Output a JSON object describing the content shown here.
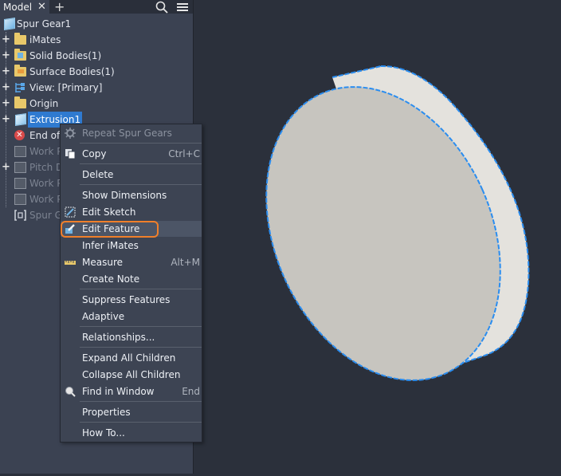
{
  "tabs": {
    "model_label": "Model",
    "close_glyph": "✕",
    "add_glyph": "+"
  },
  "tree": {
    "root": "Spur Gear1",
    "items": [
      {
        "label": "iMates",
        "icon": "folder-icon"
      },
      {
        "label": "Solid Bodies(1)",
        "icon": "solid-bodies-icon"
      },
      {
        "label": "Surface Bodies(1)",
        "icon": "surface-bodies-icon"
      },
      {
        "label": "View: [Primary]",
        "icon": "view-icon"
      },
      {
        "label": "Origin",
        "icon": "folder-icon"
      },
      {
        "label": "Extrusion1",
        "icon": "extrusion-icon",
        "selected": true
      },
      {
        "label": "End of",
        "icon": "error-icon"
      },
      {
        "label": "Work P",
        "icon": "work-plane-icon"
      },
      {
        "label": "Pitch D",
        "icon": "work-plane-icon"
      },
      {
        "label": "Work P",
        "icon": "work-plane-icon"
      },
      {
        "label": "Work P",
        "icon": "work-plane-icon"
      },
      {
        "label": "Spur G",
        "icon": "spur-gear-icon"
      }
    ]
  },
  "context_menu": {
    "repeat": "Repeat Spur Gears",
    "copy": "Copy",
    "copy_shortcut": "Ctrl+C",
    "delete": "Delete",
    "show_dimensions": "Show Dimensions",
    "edit_sketch": "Edit Sketch",
    "edit_feature": "Edit Feature",
    "infer_imates": "Infer iMates",
    "measure": "Measure",
    "measure_shortcut": "Alt+M",
    "create_note": "Create Note",
    "suppress_features": "Suppress Features",
    "adaptive": "Adaptive",
    "relationships": "Relationships...",
    "expand_all": "Expand All Children",
    "collapse_all": "Collapse All Children",
    "find_in_window": "Find in Window",
    "find_shortcut": "End",
    "properties": "Properties",
    "how_to": "How To..."
  },
  "colors": {
    "accent_selection": "#2f7ad0",
    "highlight_ring": "#f07f2a",
    "model_outline": "#2a8df0"
  }
}
